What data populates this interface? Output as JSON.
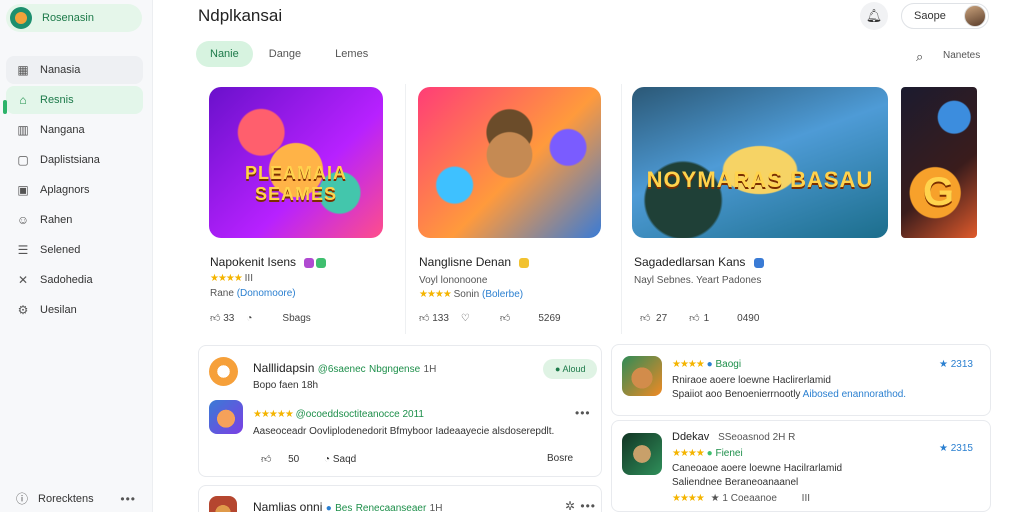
{
  "sidebar": {
    "brand": "Rosenasin",
    "items": [
      {
        "label": "Nanasia",
        "icon": "grid-icon"
      },
      {
        "label": "Resnis",
        "icon": "home-icon"
      },
      {
        "label": "Nangana",
        "icon": "chart-icon"
      },
      {
        "label": "Daplistsiana",
        "icon": "box-icon"
      },
      {
        "label": "Aplagnors",
        "icon": "apps-icon"
      },
      {
        "label": "Rahen",
        "icon": "user-icon"
      },
      {
        "label": "Selened",
        "icon": "list-icon"
      },
      {
        "label": "Sadohedia",
        "icon": "tools-icon"
      },
      {
        "label": "Uesilan",
        "icon": "settings-icon"
      }
    ],
    "footer": {
      "label": "Rorecktens",
      "more": "•••"
    }
  },
  "header": {
    "title": "Ndplkansai",
    "signin_label": "Saope"
  },
  "tabs": [
    {
      "label": "Nanie"
    },
    {
      "label": "Dange"
    },
    {
      "label": "Lemes"
    }
  ],
  "filter_label": "Nanetes",
  "featured": [
    {
      "art_text": "PLEAMAIA SEAMES",
      "name": "Napokenit Isens",
      "stars": "★★★★",
      "rating": "III",
      "meta_plain": "Rane",
      "meta_link": "(Donomoore)",
      "likes": "33",
      "action_label": "Sbags"
    },
    {
      "art_text": "",
      "name": "Nanglisne Denan",
      "stars": "★★★★",
      "rating": "",
      "meta_plain": "Voyl lononoone",
      "meta_link": "",
      "meta_extra": "Sonin",
      "meta_link2": "(Bolerbe)",
      "likes": "133",
      "count2": "5269"
    },
    {
      "art_text": "NOYMARAS BASAU",
      "name": "Sagadedlarsan Kans",
      "stars": "",
      "meta_plain": "Nayl Sebnes. Yeart Padones",
      "likes": "27",
      "count2": "1",
      "count3": "0490"
    },
    {
      "art_text": "G",
      "name": "",
      "stars": ""
    }
  ],
  "reviews_left": [
    {
      "name": "Nalllidapsin",
      "handle": "@6saenec",
      "tag": "Nbgngense",
      "rank": "1H",
      "sub": "Bopo faen",
      "sub_num": "18h",
      "chip": "Aloud",
      "line_stars": "★★★★★",
      "line_text": "@ocoeddsoctiteanocce 2011",
      "body": "Aaseoceadr Oovliplodenedorit Bfmyboor Iadeaayecie alsdoserepdlt.",
      "likes": "50",
      "reply_label": "Saqd",
      "share_label": "Bosre"
    },
    {
      "name": "Namlias onni",
      "handle": "Bes",
      "tag": "Renecaanseaer",
      "rank": "1H"
    }
  ],
  "reviews_right": [
    {
      "stars": "★★★★",
      "rate_label": "Baogi",
      "score": "★ 2313",
      "line1": "Rniraoe aoere loewne Haclirerlamid",
      "line2": "Spaiiot aoo Benoenierrnootly",
      "link": "Aibosed enannorathod."
    },
    {
      "name": "Ddekav",
      "handle": "SSeoasnod",
      "rank": "2H R",
      "stars": "★★★★",
      "rate_label": "Fienei",
      "score": "★ 2315",
      "line1": "Caneoaoe aoere loewne Hacilrarlamid",
      "line2": "Saliendnee Beraneoanaanel",
      "foot": "★ 1 Coeaanoe",
      "foot_rank": "III"
    }
  ],
  "colors": {
    "accent": "#1d8f4a",
    "accent_bg": "#e3f6ea",
    "star": "#f4b400",
    "link": "#2a7fd0"
  }
}
